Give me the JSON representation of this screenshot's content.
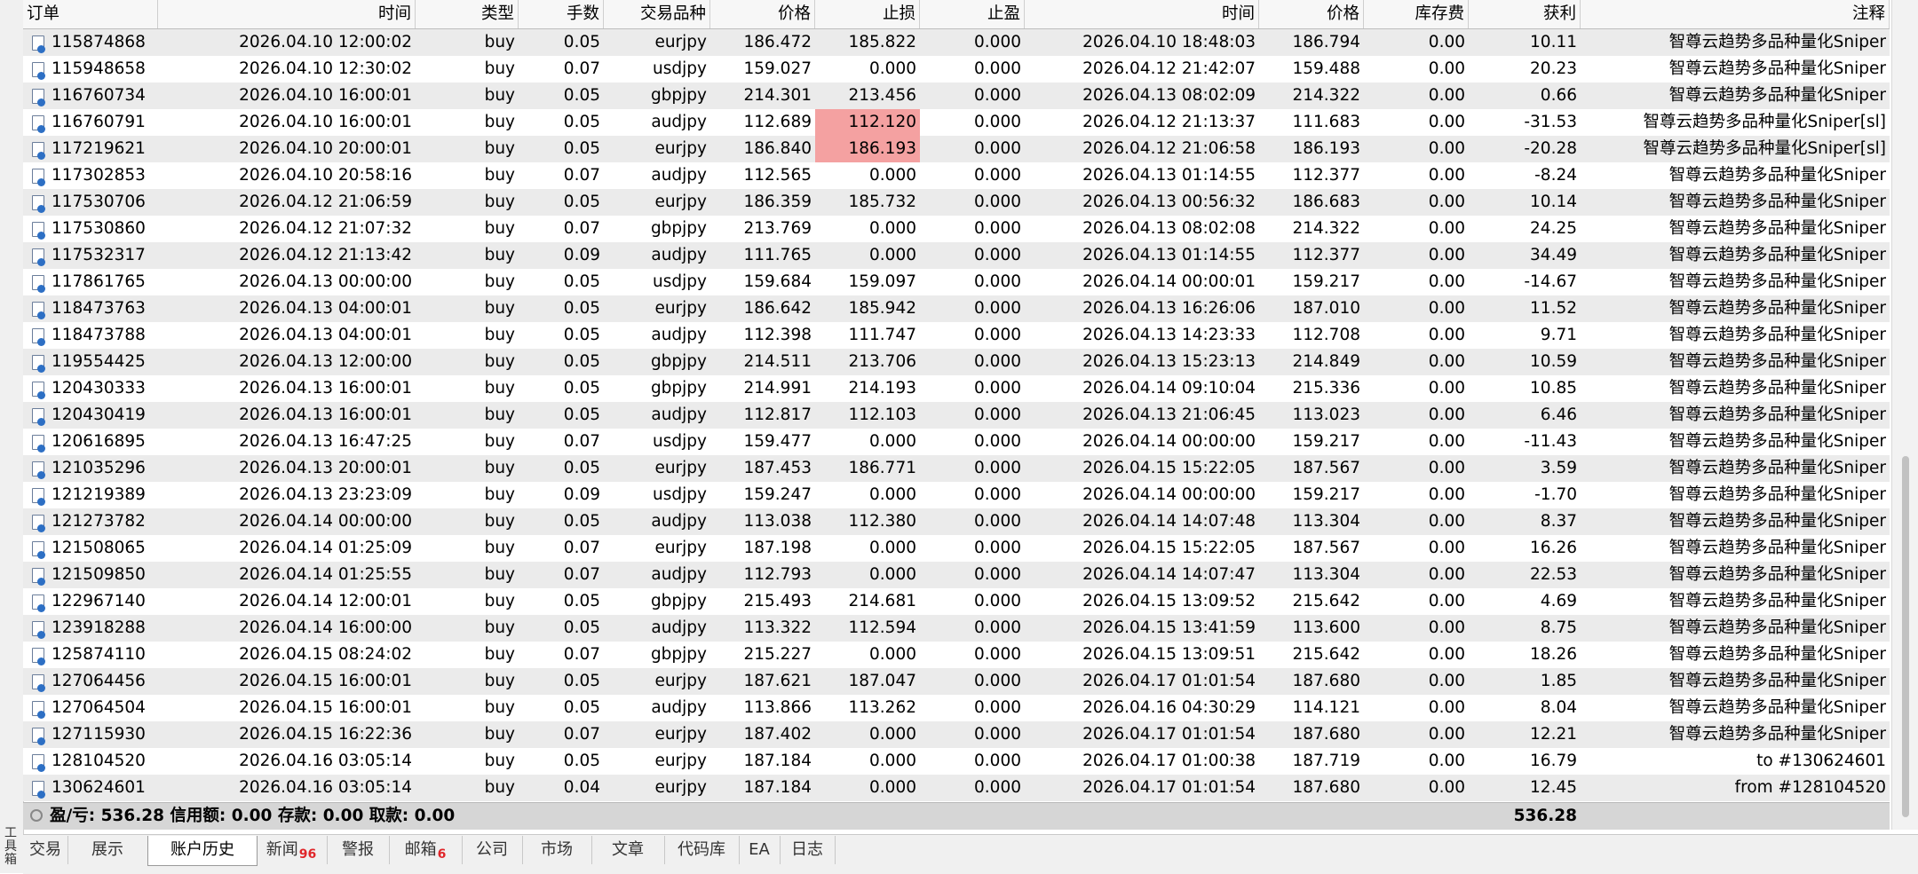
{
  "columns": [
    "订单",
    "时间",
    "类型",
    "手数",
    "交易品种",
    "价格",
    "止损",
    "止盈",
    "时间",
    "价格",
    "库存费",
    "获利",
    "注释"
  ],
  "rows": [
    [
      "115874868",
      "2026.04.10 12:00:02",
      "buy",
      "0.05",
      "eurjpy",
      "186.472",
      "185.822",
      "0.000",
      "2026.04.10 18:48:03",
      "186.794",
      "0.00",
      "10.11",
      "智尊云趋势多品种量化Sniper"
    ],
    [
      "115948658",
      "2026.04.10 12:30:02",
      "buy",
      "0.07",
      "usdjpy",
      "159.027",
      "0.000",
      "0.000",
      "2026.04.12 21:42:07",
      "159.488",
      "0.00",
      "20.23",
      "智尊云趋势多品种量化Sniper"
    ],
    [
      "116760734",
      "2026.04.10 16:00:01",
      "buy",
      "0.05",
      "gbpjpy",
      "214.301",
      "213.456",
      "0.000",
      "2026.04.13 08:02:09",
      "214.322",
      "0.00",
      "0.66",
      "智尊云趋势多品种量化Sniper"
    ],
    [
      "116760791",
      "2026.04.10 16:00:01",
      "buy",
      "0.05",
      "audjpy",
      "112.689",
      "112.120",
      "0.000",
      "2026.04.12 21:13:37",
      "111.683",
      "0.00",
      "-31.53",
      "智尊云趋势多品种量化Sniper[sl]"
    ],
    [
      "117219621",
      "2026.04.10 20:00:01",
      "buy",
      "0.05",
      "eurjpy",
      "186.840",
      "186.193",
      "0.000",
      "2026.04.12 21:06:58",
      "186.193",
      "0.00",
      "-20.28",
      "智尊云趋势多品种量化Sniper[sl]"
    ],
    [
      "117302853",
      "2026.04.10 20:58:16",
      "buy",
      "0.07",
      "audjpy",
      "112.565",
      "0.000",
      "0.000",
      "2026.04.13 01:14:55",
      "112.377",
      "0.00",
      "-8.24",
      "智尊云趋势多品种量化Sniper"
    ],
    [
      "117530706",
      "2026.04.12 21:06:59",
      "buy",
      "0.05",
      "eurjpy",
      "186.359",
      "185.732",
      "0.000",
      "2026.04.13 00:56:32",
      "186.683",
      "0.00",
      "10.14",
      "智尊云趋势多品种量化Sniper"
    ],
    [
      "117530860",
      "2026.04.12 21:07:32",
      "buy",
      "0.07",
      "gbpjpy",
      "213.769",
      "0.000",
      "0.000",
      "2026.04.13 08:02:08",
      "214.322",
      "0.00",
      "24.25",
      "智尊云趋势多品种量化Sniper"
    ],
    [
      "117532317",
      "2026.04.12 21:13:42",
      "buy",
      "0.09",
      "audjpy",
      "111.765",
      "0.000",
      "0.000",
      "2026.04.13 01:14:55",
      "112.377",
      "0.00",
      "34.49",
      "智尊云趋势多品种量化Sniper"
    ],
    [
      "117861765",
      "2026.04.13 00:00:00",
      "buy",
      "0.05",
      "usdjpy",
      "159.684",
      "159.097",
      "0.000",
      "2026.04.14 00:00:01",
      "159.217",
      "0.00",
      "-14.67",
      "智尊云趋势多品种量化Sniper"
    ],
    [
      "118473763",
      "2026.04.13 04:00:01",
      "buy",
      "0.05",
      "eurjpy",
      "186.642",
      "185.942",
      "0.000",
      "2026.04.13 16:26:06",
      "187.010",
      "0.00",
      "11.52",
      "智尊云趋势多品种量化Sniper"
    ],
    [
      "118473788",
      "2026.04.13 04:00:01",
      "buy",
      "0.05",
      "audjpy",
      "112.398",
      "111.747",
      "0.000",
      "2026.04.13 14:23:33",
      "112.708",
      "0.00",
      "9.71",
      "智尊云趋势多品种量化Sniper"
    ],
    [
      "119554425",
      "2026.04.13 12:00:00",
      "buy",
      "0.05",
      "gbpjpy",
      "214.511",
      "213.706",
      "0.000",
      "2026.04.13 15:23:13",
      "214.849",
      "0.00",
      "10.59",
      "智尊云趋势多品种量化Sniper"
    ],
    [
      "120430333",
      "2026.04.13 16:00:01",
      "buy",
      "0.05",
      "gbpjpy",
      "214.991",
      "214.193",
      "0.000",
      "2026.04.14 09:10:04",
      "215.336",
      "0.00",
      "10.85",
      "智尊云趋势多品种量化Sniper"
    ],
    [
      "120430419",
      "2026.04.13 16:00:01",
      "buy",
      "0.05",
      "audjpy",
      "112.817",
      "112.103",
      "0.000",
      "2026.04.13 21:06:45",
      "113.023",
      "0.00",
      "6.46",
      "智尊云趋势多品种量化Sniper"
    ],
    [
      "120616895",
      "2026.04.13 16:47:25",
      "buy",
      "0.07",
      "usdjpy",
      "159.477",
      "0.000",
      "0.000",
      "2026.04.14 00:00:00",
      "159.217",
      "0.00",
      "-11.43",
      "智尊云趋势多品种量化Sniper"
    ],
    [
      "121035296",
      "2026.04.13 20:00:01",
      "buy",
      "0.05",
      "eurjpy",
      "187.453",
      "186.771",
      "0.000",
      "2026.04.15 15:22:05",
      "187.567",
      "0.00",
      "3.59",
      "智尊云趋势多品种量化Sniper"
    ],
    [
      "121219389",
      "2026.04.13 23:23:09",
      "buy",
      "0.09",
      "usdjpy",
      "159.247",
      "0.000",
      "0.000",
      "2026.04.14 00:00:00",
      "159.217",
      "0.00",
      "-1.70",
      "智尊云趋势多品种量化Sniper"
    ],
    [
      "121273782",
      "2026.04.14 00:00:00",
      "buy",
      "0.05",
      "audjpy",
      "113.038",
      "112.380",
      "0.000",
      "2026.04.14 14:07:48",
      "113.304",
      "0.00",
      "8.37",
      "智尊云趋势多品种量化Sniper"
    ],
    [
      "121508065",
      "2026.04.14 01:25:09",
      "buy",
      "0.07",
      "eurjpy",
      "187.198",
      "0.000",
      "0.000",
      "2026.04.15 15:22:05",
      "187.567",
      "0.00",
      "16.26",
      "智尊云趋势多品种量化Sniper"
    ],
    [
      "121509850",
      "2026.04.14 01:25:55",
      "buy",
      "0.07",
      "audjpy",
      "112.793",
      "0.000",
      "0.000",
      "2026.04.14 14:07:47",
      "113.304",
      "0.00",
      "22.53",
      "智尊云趋势多品种量化Sniper"
    ],
    [
      "122967140",
      "2026.04.14 12:00:01",
      "buy",
      "0.05",
      "gbpjpy",
      "215.493",
      "214.681",
      "0.000",
      "2026.04.15 13:09:52",
      "215.642",
      "0.00",
      "4.69",
      "智尊云趋势多品种量化Sniper"
    ],
    [
      "123918288",
      "2026.04.14 16:00:00",
      "buy",
      "0.05",
      "audjpy",
      "113.322",
      "112.594",
      "0.000",
      "2026.04.15 13:41:59",
      "113.600",
      "0.00",
      "8.75",
      "智尊云趋势多品种量化Sniper"
    ],
    [
      "125874110",
      "2026.04.15 08:24:02",
      "buy",
      "0.07",
      "gbpjpy",
      "215.227",
      "0.000",
      "0.000",
      "2026.04.15 13:09:51",
      "215.642",
      "0.00",
      "18.26",
      "智尊云趋势多品种量化Sniper"
    ],
    [
      "127064456",
      "2026.04.15 16:00:01",
      "buy",
      "0.05",
      "eurjpy",
      "187.621",
      "187.047",
      "0.000",
      "2026.04.17 01:01:54",
      "187.680",
      "0.00",
      "1.85",
      "智尊云趋势多品种量化Sniper"
    ],
    [
      "127064504",
      "2026.04.15 16:00:01",
      "buy",
      "0.05",
      "audjpy",
      "113.866",
      "113.262",
      "0.000",
      "2026.04.16 04:30:29",
      "114.121",
      "0.00",
      "8.04",
      "智尊云趋势多品种量化Sniper"
    ],
    [
      "127115930",
      "2026.04.15 16:22:36",
      "buy",
      "0.07",
      "eurjpy",
      "187.402",
      "0.000",
      "0.000",
      "2026.04.17 01:01:54",
      "187.680",
      "0.00",
      "12.21",
      "智尊云趋势多品种量化Sniper"
    ],
    [
      "128104520",
      "2026.04.16 03:05:14",
      "buy",
      "0.05",
      "eurjpy",
      "187.184",
      "0.000",
      "0.000",
      "2026.04.17 01:00:38",
      "187.719",
      "0.00",
      "16.79",
      "to #130624601"
    ],
    [
      "130624601",
      "2026.04.16 03:05:14",
      "buy",
      "0.04",
      "eurjpy",
      "187.184",
      "0.000",
      "0.000",
      "2026.04.17 01:01:54",
      "187.680",
      "0.00",
      "12.45",
      "from #128104520"
    ]
  ],
  "highlight_color": "#f4a1a1",
  "highlighted_stoploss_rows": [
    3,
    4
  ],
  "summary": {
    "text": "盈/亏: 536.28  信用额: 0.00  存款: 0.00  取款: 0.00",
    "total_profit": "536.28"
  },
  "tabs": [
    {
      "label": "交易"
    },
    {
      "label": "展示"
    },
    {
      "label": "账户历史",
      "active": true
    },
    {
      "label": "新闻",
      "badge": "96"
    },
    {
      "label": "警报"
    },
    {
      "label": "邮箱",
      "badge": "6"
    },
    {
      "label": "公司"
    },
    {
      "label": "市场"
    },
    {
      "label": "文章"
    },
    {
      "label": "代码库"
    },
    {
      "label": "EA"
    },
    {
      "label": "日志"
    }
  ],
  "side_label": "工具箱"
}
